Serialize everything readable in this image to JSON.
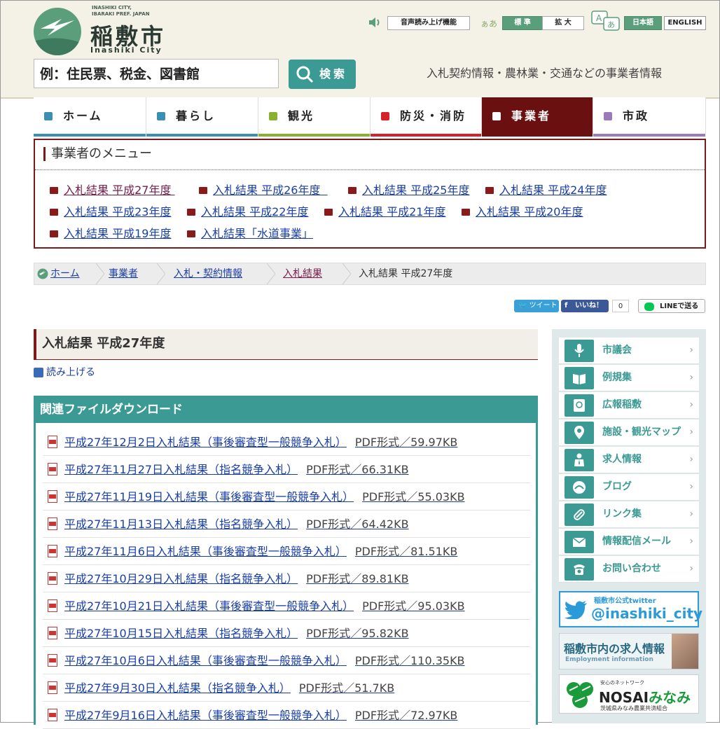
{
  "header": {
    "logo_small_line1": "INASHIKI CITY,",
    "logo_small_line2": "IBARAKI PREF. JAPAN",
    "logo_name": "稲敷市",
    "logo_en": "Inashiki City",
    "tts_button": "音声読み上げ機能",
    "font_size_label": "ぁあ",
    "size_standard": "標 準",
    "size_large": "拡 大",
    "lang_ja": "日本語",
    "lang_en": "ENGLISH",
    "search_placeholder": "例：住民票、税金、図書館",
    "search_button": "検索",
    "tagline": "入札契約情報・農林業・交通などの事業者情報"
  },
  "nav": [
    {
      "label": "ホーム",
      "color": "#3b8fb0"
    },
    {
      "label": "暮らし",
      "color": "#3b8fb0"
    },
    {
      "label": "観光",
      "color": "#8ab030"
    },
    {
      "label": "防災・消防",
      "color": "#d8202a"
    },
    {
      "label": "事業者",
      "color": "#6b1010"
    },
    {
      "label": "市政",
      "color": "#9a7ab8"
    }
  ],
  "menu": {
    "title": "事業者のメニュー",
    "links": [
      "入札結果 平成27年度",
      "入札結果 平成26年度",
      "入札結果 平成25年度",
      "入札結果 平成24年度",
      "入札結果 平成23年度",
      "入札結果 平成22年度",
      "入札結果 平成21年度",
      "入札結果 平成20年度",
      "入札結果 平成19年度",
      "入札結果「水道事業」"
    ]
  },
  "breadcrumb": [
    "ホーム",
    "事業者",
    "入札・契約情報",
    "入札結果",
    "入札結果 平成27年度"
  ],
  "social": {
    "tweet": "ツイート",
    "like": "いいね！",
    "like_count": "0",
    "line": "LINEで送る"
  },
  "page": {
    "title": "入札結果 平成27年度",
    "read_aloud": "読み上げる"
  },
  "downloads": {
    "heading": "関連ファイルダウンロード",
    "files": [
      {
        "name": "平成27年12月2日入札結果（事後審査型一般競争入札）",
        "meta": "PDF形式／59.97KB"
      },
      {
        "name": "平成27年11月27日入札結果（指名競争入札）",
        "meta": "PDF形式／66.31KB"
      },
      {
        "name": "平成27年11月19日入札結果（事後審査型一般競争入札）",
        "meta": "PDF形式／55.03KB"
      },
      {
        "name": "平成27年11月13日入札結果（指名競争入札）",
        "meta": "PDF形式／64.42KB"
      },
      {
        "name": "平成27年11月6日入札結果（事後審査型一般競争入札）",
        "meta": "PDF形式／81.51KB"
      },
      {
        "name": "平成27年10月29日入札結果（指名競争入札）",
        "meta": "PDF形式／89.81KB"
      },
      {
        "name": "平成27年10月21日入札結果（事後審査型一般競争入札）",
        "meta": "PDF形式／95.03KB"
      },
      {
        "name": "平成27年10月15日入札結果（指名競争入札）",
        "meta": "PDF形式／95.82KB"
      },
      {
        "name": "平成27年10月6日入札結果（事後審査型一般競争入札）",
        "meta": "PDF形式／110.35KB"
      },
      {
        "name": "平成27年9月30日入札結果（指名競争入札）",
        "meta": "PDF形式／51.7KB"
      },
      {
        "name": "平成27年9月16日入札結果（事後審査型一般競争入札）",
        "meta": "PDF形式／72.97KB"
      }
    ]
  },
  "sidebar": {
    "items": [
      {
        "label": "市議会",
        "icon": "microphone-icon"
      },
      {
        "label": "例規集",
        "icon": "book-icon"
      },
      {
        "label": "広報稲敷",
        "icon": "newsletter-icon"
      },
      {
        "label": "施設・観光マップ",
        "icon": "map-pin-icon"
      },
      {
        "label": "求人情報",
        "icon": "job-icon"
      },
      {
        "label": "ブログ",
        "icon": "blog-icon"
      },
      {
        "label": "リンク集",
        "icon": "link-icon"
      },
      {
        "label": "情報配信メール",
        "icon": "mail-icon"
      },
      {
        "label": "お問い合わせ",
        "icon": "phone-icon"
      }
    ],
    "twitter_small": "稲敷市公式twitter",
    "twitter_handle": "@inashiki_city",
    "job_title": "稲敷市内の求人情報",
    "job_sub": "Employment information",
    "nosai_small": "安心のネットワーク",
    "nosai_title_a": "NOSAI",
    "nosai_title_b": "みなみ",
    "nosai_sub": "茨城県みなみ農業共済組合"
  }
}
